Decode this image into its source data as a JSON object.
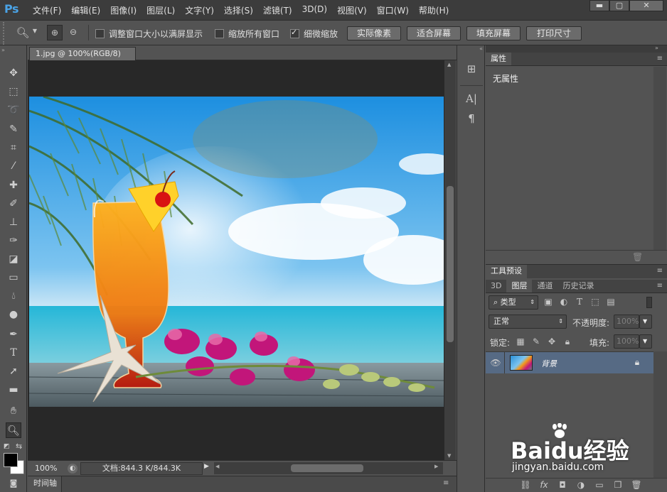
{
  "app": {
    "logo": "Ps"
  },
  "menu": [
    "文件(F)",
    "编辑(E)",
    "图像(I)",
    "图层(L)",
    "文字(Y)",
    "选择(S)",
    "滤镜(T)",
    "3D(D)",
    "视图(V)",
    "窗口(W)",
    "帮助(H)"
  ],
  "window_controls": {
    "minimize": "▬",
    "maximize": "▢",
    "close": "✕"
  },
  "options": {
    "resize_window_label": "调整窗口大小以满屏显示",
    "resize_window_checked": false,
    "zoom_all_label": "缩放所有窗口",
    "zoom_all_checked": false,
    "scrubby_zoom_label": "细微缩放",
    "scrubby_zoom_checked": true,
    "buttons": [
      "实际像素",
      "适合屏幕",
      "填充屏幕",
      "打印尺寸"
    ]
  },
  "document": {
    "tab_title": "1.jpg @ 100%(RGB/8)",
    "tab_close": "×",
    "zoom": "100%",
    "doc_info": "文档:844.3 K/844.3K"
  },
  "timeline": {
    "label": "时间轴"
  },
  "properties": {
    "title": "属性",
    "empty_text": "无属性"
  },
  "tool_presets": {
    "title": "工具预设"
  },
  "layers_panel": {
    "tabs": [
      "3D",
      "图层",
      "通道",
      "历史记录"
    ],
    "active_tab": "图层",
    "filter_kind": "类型",
    "blend_mode": "正常",
    "opacity_label": "不透明度:",
    "opacity_value": "100%",
    "lock_label": "锁定:",
    "fill_label": "填充:",
    "fill_value": "100%",
    "layers": [
      {
        "name": "背景",
        "visible": true,
        "locked": true
      }
    ]
  },
  "watermark": {
    "brand": "Baidu经验",
    "url": "jingyan.baidu.com"
  }
}
